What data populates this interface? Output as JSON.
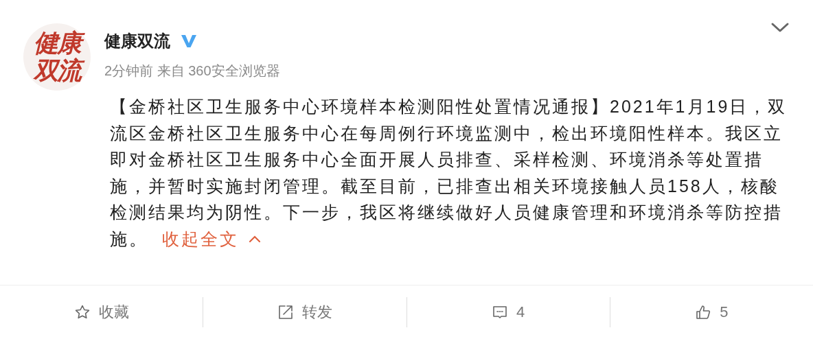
{
  "author": {
    "avatar_text": "健康双流",
    "name": "健康双流",
    "verified": true,
    "meta": "2分钟前 来自 360安全浏览器"
  },
  "post": {
    "text": "【金桥社区卫生服务中心环境样本检测阳性处置情况通报】2021年1月19日，双流区金桥社区卫生服务中心在每周例行环境监测中，检出环境阳性样本。我区立即对金桥社区卫生服务中心全面开展人员排查、采样检测、环境消杀等处置措施，并暂时实施封闭管理。截至目前，已排查出相关环境接触人员158人，核酸检测结果均为阴性。下一步，我区将继续做好人员健康管理和环境消杀等防控措施。",
    "collapse_link": "收起全文"
  },
  "actions": [
    {
      "kind": "favorite",
      "label": "收藏"
    },
    {
      "kind": "repost",
      "label": "转发"
    },
    {
      "kind": "comment",
      "label": "4"
    },
    {
      "kind": "like",
      "label": "5"
    }
  ]
}
